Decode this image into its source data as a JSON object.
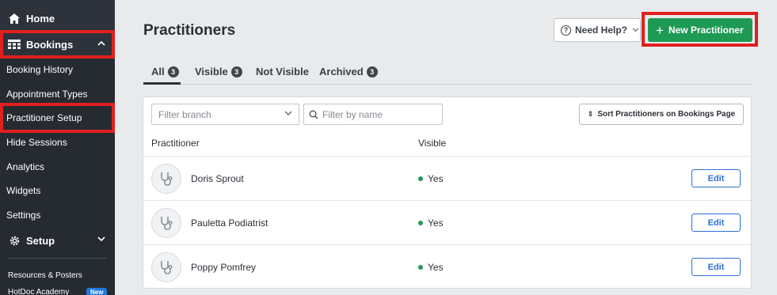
{
  "sidebar": {
    "home": "Home",
    "bookings": "Bookings",
    "items": [
      {
        "label": "Booking History"
      },
      {
        "label": "Appointment Types"
      },
      {
        "label": "Practitioner Setup"
      },
      {
        "label": "Hide Sessions"
      },
      {
        "label": "Analytics"
      },
      {
        "label": "Widgets"
      },
      {
        "label": "Settings"
      }
    ],
    "setup": "Setup",
    "resources": "Resources & Posters",
    "academy": "HotDoc Academy",
    "academy_badge": "New"
  },
  "header": {
    "title": "Practitioners",
    "help_label": "Need Help?",
    "new_label": "New Practitioner"
  },
  "tabs": [
    {
      "label": "All",
      "count": "3"
    },
    {
      "label": "Visible",
      "count": "3"
    },
    {
      "label": "Not Visible",
      "count": ""
    },
    {
      "label": "Archived",
      "count": "3"
    }
  ],
  "filters": {
    "branch_placeholder": "Filter branch",
    "name_placeholder": "Filter by name",
    "sort_label": "Sort Practitioners on Bookings Page"
  },
  "table": {
    "col_practitioner": "Practitioner",
    "col_visible": "Visible",
    "rows": [
      {
        "name": "Doris Sprout",
        "visible": "Yes",
        "action": "Edit"
      },
      {
        "name": "Pauletta Podiatrist",
        "visible": "Yes",
        "action": "Edit"
      },
      {
        "name": "Poppy Pomfrey",
        "visible": "Yes",
        "action": "Edit"
      }
    ]
  },
  "colors": {
    "sidebar": "#2e333b",
    "primary_green": "#1e9a55",
    "highlight_red": "#e02020",
    "link_blue": "#2f6fd6"
  }
}
